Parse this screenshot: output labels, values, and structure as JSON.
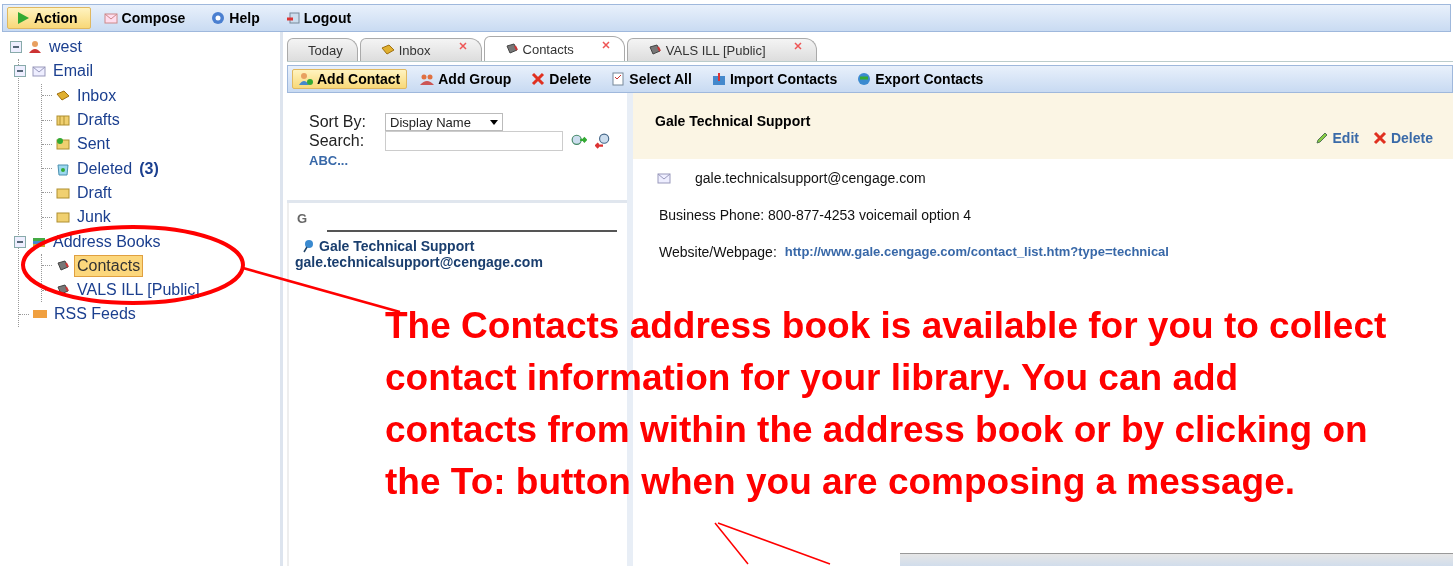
{
  "menu": [
    {
      "label": "Action",
      "kind": "play",
      "selected": true
    },
    {
      "label": "Compose",
      "kind": "compose",
      "selected": false
    },
    {
      "label": "Help",
      "kind": "help",
      "selected": false
    },
    {
      "label": "Logout",
      "kind": "logout",
      "selected": false
    }
  ],
  "tree": [
    {
      "label": "west",
      "kind": "user",
      "expanded": true,
      "children": [
        {
          "label": "Email",
          "kind": "mail",
          "expanded": true,
          "children": [
            {
              "label": "Inbox",
              "kind": "inbox",
              "selected": false
            },
            {
              "label": "Drafts",
              "kind": "drafts",
              "selected": false
            },
            {
              "label": "Sent",
              "kind": "sent",
              "selected": false
            },
            {
              "label": "Deleted",
              "count": "(3)",
              "kind": "trash",
              "selected": false
            },
            {
              "label": "Draft",
              "kind": "folder",
              "selected": false
            },
            {
              "label": "Junk",
              "kind": "folder",
              "selected": false
            }
          ]
        },
        {
          "label": "Address Books",
          "kind": "books",
          "expanded": true,
          "children": [
            {
              "label": "Contacts",
              "kind": "book",
              "selected": true
            },
            {
              "label": "VALS ILL [Public]",
              "kind": "book",
              "selected": false
            }
          ]
        },
        {
          "label": "RSS Feeds",
          "kind": "rss",
          "selected": false
        }
      ]
    }
  ],
  "tabs": [
    {
      "label": "Today",
      "kind": "plain",
      "closable": false,
      "selected": false
    },
    {
      "label": "Inbox",
      "kind": "inbox",
      "closable": true,
      "selected": false
    },
    {
      "label": "Contacts",
      "kind": "book",
      "closable": true,
      "selected": true
    },
    {
      "label": "VALS ILL [Public]",
      "kind": "book",
      "closable": true,
      "selected": false
    }
  ],
  "toolbar": [
    {
      "label": "Add Contact",
      "kind": "add-contact",
      "selected": true
    },
    {
      "label": "Add Group",
      "kind": "add-group",
      "selected": false
    },
    {
      "label": "Delete",
      "kind": "delete",
      "selected": false
    },
    {
      "label": "Select All",
      "kind": "select-all",
      "selected": false
    },
    {
      "label": "Import Contacts",
      "kind": "import",
      "selected": false
    },
    {
      "label": "Export Contacts",
      "kind": "export",
      "selected": false
    }
  ],
  "contact_list": {
    "sort_label": "Sort By:",
    "sort_value": "Display Name",
    "search_label": "Search:",
    "abc_link": "ABC...",
    "group_letter": "G",
    "contacts": [
      {
        "name": "Gale Technical Support",
        "email": "gale.technicalsupport@cengage.com"
      }
    ]
  },
  "detail": {
    "name": "Gale Technical Support",
    "actions": [
      {
        "label": "Edit",
        "kind": "edit"
      },
      {
        "label": "Delete",
        "kind": "delete"
      }
    ],
    "email": "gale.technicalsupport@cengage.com",
    "phone": "Business Phone: 800-877-4253 voicemail option 4",
    "website_label": "Website/Webpage:",
    "website_url": "http://www.gale.cengage.com/contact_list.htm?type=technical"
  },
  "annotation": {
    "text": "The Contacts address book is available for you to collect contact information for your library. You can add contacts from within the address book or by clicking on the To: button when you are composing a message."
  }
}
